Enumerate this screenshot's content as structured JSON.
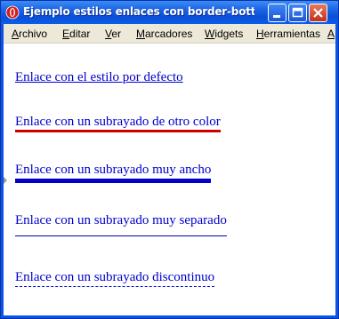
{
  "window": {
    "title": "Ejemplo estilos enlaces con border-bottom -..."
  },
  "menu": [
    {
      "label_first": "A",
      "label_rest": "rchivo"
    },
    {
      "label_first": "E",
      "label_rest": "ditar"
    },
    {
      "label_first": "V",
      "label_rest": "er"
    },
    {
      "label_first": "M",
      "label_rest": "arcadores"
    },
    {
      "label_first": "W",
      "label_rest": "idgets"
    },
    {
      "label_first": "H",
      "label_rest": "erramientas"
    },
    {
      "label_first": "A",
      "label_rest": ""
    }
  ],
  "links": [
    {
      "text": "Enlace con el estilo por defecto"
    },
    {
      "text": "Enlace con un subrayado de otro color"
    },
    {
      "text": "Enlace con un subrayado muy ancho"
    },
    {
      "text": "Enlace con un subrayado muy separado"
    },
    {
      "text": "Enlace con un subrayado discontinuo"
    }
  ],
  "colors": {
    "link": "#0000cc",
    "red_underline": "#cc0000",
    "titlebar": "#0a55e6"
  }
}
